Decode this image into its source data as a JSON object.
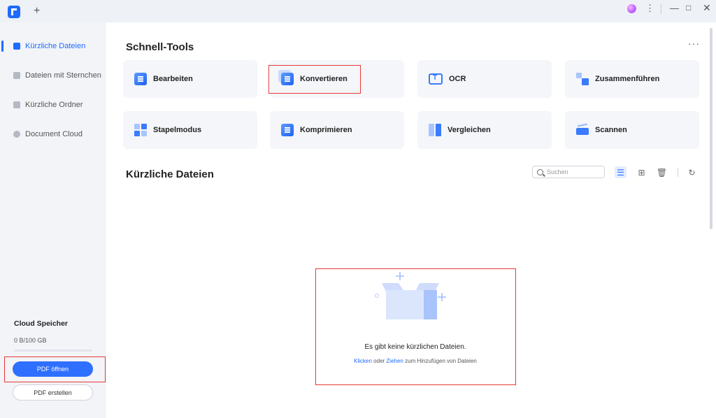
{
  "titlebar": {
    "new_tab_icon": "+",
    "icons": [
      "app-logo-icon",
      "plus-icon",
      "avatar-icon",
      "more-vertical-icon",
      "minimize-icon",
      "maximize-icon",
      "close-icon"
    ]
  },
  "sidebar": {
    "items": [
      {
        "label": "Kürzliche Dateien",
        "icon": "recent-files-icon"
      },
      {
        "label": "Dateien mit Sternchen",
        "icon": "starred-files-icon"
      },
      {
        "label": "Kürzliche Ordner",
        "icon": "folder-icon"
      },
      {
        "label": "Document Cloud",
        "icon": "cloud-icon"
      }
    ],
    "cloud": {
      "title": "Cloud Speicher",
      "usage": "0 B/100 GB",
      "usage_fraction": 0
    },
    "open_button": "PDF öffnen",
    "create_button": "PDF erstellen"
  },
  "tools": {
    "title": "Schnell-Tools",
    "more": "···",
    "items": [
      {
        "label": "Bearbeiten",
        "icon": "edit-icon"
      },
      {
        "label": "Konvertieren",
        "icon": "convert-icon"
      },
      {
        "label": "OCR",
        "icon": "ocr-icon"
      },
      {
        "label": "Zusammenführen",
        "icon": "merge-icon"
      },
      {
        "label": "Stapelmodus",
        "icon": "batch-icon"
      },
      {
        "label": "Komprimieren",
        "icon": "compress-icon"
      },
      {
        "label": "Vergleichen",
        "icon": "compare-icon"
      },
      {
        "label": "Scannen",
        "icon": "scan-icon"
      }
    ]
  },
  "recent": {
    "title": "Kürzliche Dateien",
    "search_placeholder": "Suchen",
    "empty_message": "Es gibt keine kürzlichen Dateien.",
    "hint_click": "Klicken",
    "hint_or": " oder ",
    "hint_drag": "Ziehen",
    "hint_rest": " zum Hinzufügen von Dateien"
  },
  "colors": {
    "accent": "#1f6bff",
    "highlight": "#e53935",
    "sidebar_bg": "#f2f4f8",
    "tile_bg": "#f4f6f9"
  }
}
